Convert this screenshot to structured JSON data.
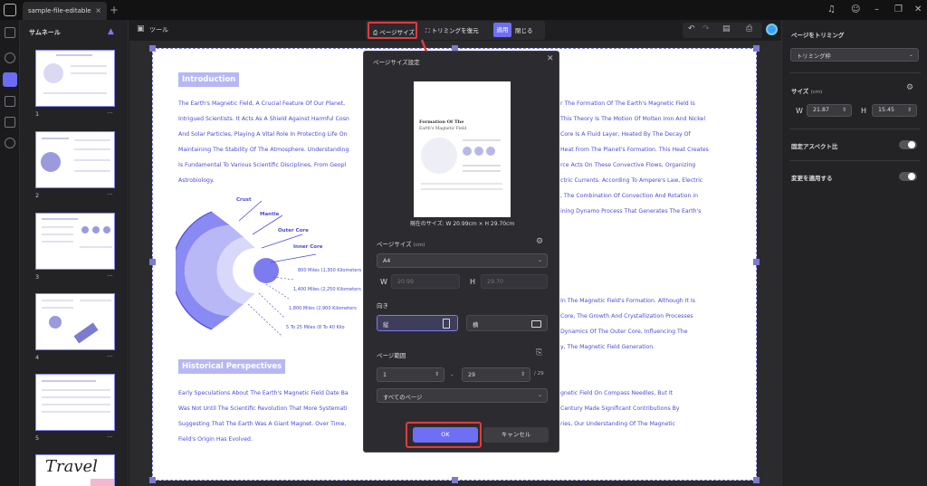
{
  "titlebar": {
    "tab_label": "sample-file-editable",
    "tab_close": "×",
    "tab_add": "+"
  },
  "thumbnails": {
    "title": "サムネール",
    "pages": [
      {
        "num": "1",
        "more": "···"
      },
      {
        "num": "2",
        "more": "···"
      },
      {
        "num": "3",
        "more": "···"
      },
      {
        "num": "4",
        "more": "···"
      },
      {
        "num": "5",
        "more": "···"
      }
    ],
    "cover_text": "Travel"
  },
  "toolbar": {
    "tools": "ツール",
    "page_size": "ページサイズ",
    "restore_trim": "トリミングを復元",
    "apply": "適用",
    "close": "閉じる"
  },
  "document": {
    "intro_heading": "Introduction",
    "intro_lines": [
      "The Earth's Magnetic Field, A Crucial Feature Of Our Planet,",
      "Intrigued Scientists. It Acts As A Shield Against Harmful Cosn",
      "And Solar Particles, Playing A Vital Role In Protecting Life On",
      "Maintaining The Stability Of The Atmosphere. Understanding",
      "Is Fundamental To Various Scientific Disciplines, From Geopl",
      "Astrobiology."
    ],
    "right_lines_1": [
      "r The Formation Of The Earth's Magnetic Field Is",
      "This Theory Is The Motion Of Molten Iron And Nickel",
      "Core Is A Fluid Layer, Heated By The Decay Of",
      "Heat From The Planet's Formation. This Heat Creates",
      "",
      "rce Acts On These Convective Flows, Organizing",
      "ctric Currents. According To Ampere's Law, Electric",
      ", The Combination Of Convection And Rotation in",
      "ining Dynamo Process That Generates The Earth's"
    ],
    "right_lines_2": [
      "In The Magnetic Field's Formation. Although It Is",
      "Core, The Growth And Crystallization Processes",
      "Dynamics Of The Outer Core, Influencing The",
      "y, The Magnetic Field Generation."
    ],
    "layers": {
      "crust": "Crust",
      "mantle": "Mantle",
      "outer_core": "Outer Core",
      "inner_core": "Inner Core"
    },
    "distances": [
      "800 Miles (1,300 Kilometers",
      "1,400 Miles (2,250 Kilometers",
      "1,800 Miles (2,900 Kilometers",
      "5 To 25 Miles (8 To 40 Kilo"
    ],
    "hist_heading": "Historical Perspectives",
    "hist_lines": [
      "Early Speculations About The Earth's Magnetic Field Date Ba",
      "Was Not Until The Scientific Revolution That More Systemati",
      "Suggesting That The Earth Was A Giant Magnet. Over Time,",
      "Field's Origin Has Evolved."
    ],
    "hist_right_lines": [
      "gnetic Field On Compass Needles, But It",
      "Century Made Significant Contributions By",
      "ries, Our Understanding Of The Magnetic",
      ""
    ]
  },
  "modal": {
    "title": "ページサイズ設定",
    "current_size": "現在のサイズ: W 20.99cm × H 29.70cm",
    "page_size_label": "ページサイズ",
    "page_size_unit": "(cm)",
    "page_size_value": "A4",
    "w_label": "W",
    "w_value": "20.99",
    "h_label": "H",
    "h_value": "29.70",
    "orientation_label": "向き",
    "portrait": "縦",
    "landscape": "横",
    "range_label": "ページ範囲",
    "range_from": "1",
    "range_dash": "-",
    "range_to": "29",
    "range_total": "/ 29",
    "range_subset": "すべてのページ",
    "ok": "OK",
    "cancel": "キャンセル",
    "preview_title": "Formation Of The",
    "preview_subtitle": "Earth's Magnetic Field"
  },
  "rightpanel": {
    "title": "ページをトリミング",
    "trim_select": "トリミング枠",
    "size_label": "サイズ",
    "size_unit": "(cm)",
    "w_label": "W",
    "w_value": "21.87",
    "h_label": "H",
    "h_value": "15.45",
    "aspect_label": "固定アスペクト比",
    "apply_change_label": "変更を適用する"
  },
  "colors": {
    "accent": "#6f6ff5",
    "highlight": "#e03c3c",
    "doc_text": "#4a4ad8"
  }
}
